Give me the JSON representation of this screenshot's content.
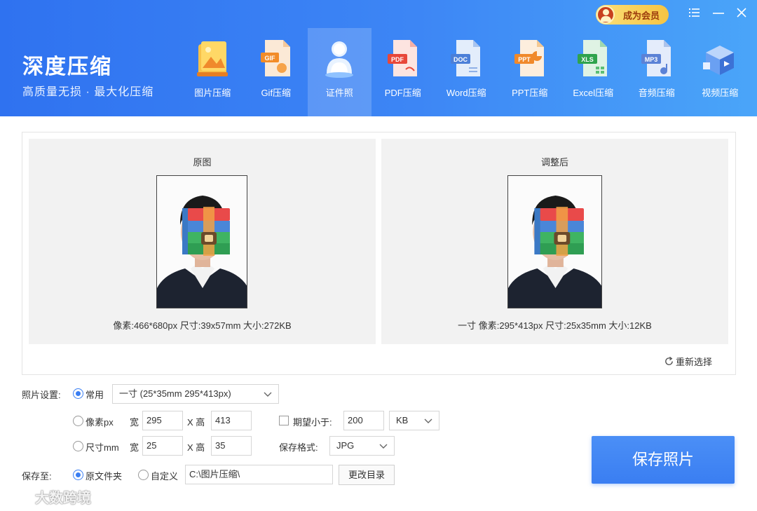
{
  "app": {
    "title": "深度压缩",
    "subtitle": "高质量无损 · 最大化压缩",
    "member_button": "成为会员"
  },
  "window_controls": [
    "menu-icon",
    "minimize-icon",
    "close-icon"
  ],
  "tabs": [
    {
      "label": "图片压缩",
      "icon": "image-icon",
      "active": false
    },
    {
      "label": "Gif压缩",
      "icon": "gif-file-icon",
      "active": false
    },
    {
      "label": "证件照",
      "icon": "id-photo-icon",
      "active": true
    },
    {
      "label": "PDF压缩",
      "icon": "pdf-file-icon",
      "active": false
    },
    {
      "label": "Word压缩",
      "icon": "doc-file-icon",
      "active": false
    },
    {
      "label": "PPT压缩",
      "icon": "ppt-file-icon",
      "active": false
    },
    {
      "label": "Excel压缩",
      "icon": "xls-file-icon",
      "active": false
    },
    {
      "label": "音频压缩",
      "icon": "mp3-file-icon",
      "active": false
    },
    {
      "label": "视频压缩",
      "icon": "video-icon",
      "active": false
    }
  ],
  "icon_texts": {
    "gif": "GIF",
    "pdf": "PDF",
    "doc": "DOC",
    "ppt": "PPT",
    "xls": "XLS",
    "mp3": "MP3"
  },
  "preview": {
    "original": {
      "title": "原图",
      "info": "像素:466*680px  尺寸:39x57mm  大小:272KB"
    },
    "adjusted": {
      "title": "调整后",
      "info": "一寸  像素:295*413px  尺寸:25x35mm  大小:12KB"
    },
    "reselect": "重新选择"
  },
  "settings": {
    "photo_label": "照片设置:",
    "common": {
      "label": "常用",
      "checked": true,
      "value": "一寸 (25*35mm 295*413px)"
    },
    "pixel": {
      "label": "像素px",
      "checked": false,
      "width_label": "宽",
      "width": "295",
      "height_label": "X 高",
      "height": "413"
    },
    "size": {
      "label": "尺寸mm",
      "checked": false,
      "width_label": "宽",
      "width": "25",
      "height_label": "X 高",
      "height": "35"
    },
    "expect": {
      "label": "期望小于:",
      "checked": false,
      "value": "200",
      "unit": "KB"
    },
    "format": {
      "label": "保存格式:",
      "value": "JPG"
    },
    "save_to": {
      "label": "保存至:",
      "original_folder": {
        "label": "原文件夹",
        "checked": true
      },
      "custom": {
        "label": "自定义",
        "checked": false
      },
      "path": "C:\\图片压缩\\",
      "change_dir": "更改目录"
    },
    "save_button": "保存照片"
  },
  "watermark": "大数跨境",
  "colors": {
    "header_start": "#2f72f0",
    "header_end": "#4aa5f9",
    "accent": "#3a7ef2",
    "member_gold": "#f6c443"
  }
}
